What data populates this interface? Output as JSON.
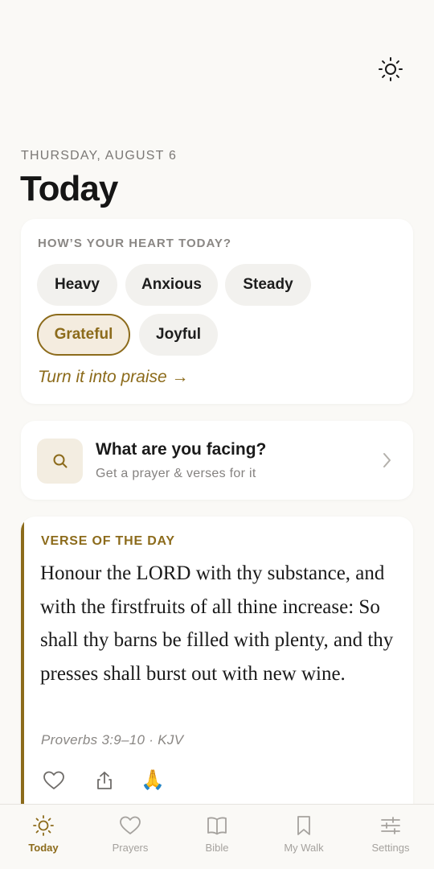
{
  "header": {
    "theme_toggle_icon": "sun-icon",
    "date": "THURSDAY, AUGUST 6",
    "title": "Today"
  },
  "heart_card": {
    "label": "HOW’S YOUR HEART TODAY?",
    "moods": [
      {
        "label": "Heavy",
        "selected": false
      },
      {
        "label": "Anxious",
        "selected": false
      },
      {
        "label": "Steady",
        "selected": false
      },
      {
        "label": "Grateful",
        "selected": true
      },
      {
        "label": "Joyful",
        "selected": false
      }
    ],
    "action_link": "Turn it into praise →"
  },
  "facing_card": {
    "icon": "search-icon",
    "title": "What are you facing?",
    "subtitle": "Get a prayer & verses for it"
  },
  "verse_card": {
    "label": "VERSE OF THE DAY",
    "text": "Honour the LORD with thy substance, and with the firstfruits of all thine increase: So shall thy barns be filled with plenty, and thy presses shall burst out with new wine.",
    "reference": "Proverbs 3:9–10 · KJV",
    "actions": [
      "heart-icon",
      "share-icon",
      "praying-hands-icon"
    ],
    "pray_emoji": "🙏"
  },
  "tabbar": {
    "tabs": [
      {
        "label": "Today",
        "icon": "sun-icon",
        "active": true
      },
      {
        "label": "Prayers",
        "icon": "heart-icon",
        "active": false
      },
      {
        "label": "Bible",
        "icon": "book-icon",
        "active": false
      },
      {
        "label": "My Walk",
        "icon": "bookmark-icon",
        "active": false
      },
      {
        "label": "Settings",
        "icon": "sliders-icon",
        "active": false
      }
    ]
  },
  "colors": {
    "accent": "#8c6b1b",
    "background": "#faf9f6",
    "card": "#ffffff",
    "chip": "#f2f1ee",
    "muted": "#8a8784"
  }
}
